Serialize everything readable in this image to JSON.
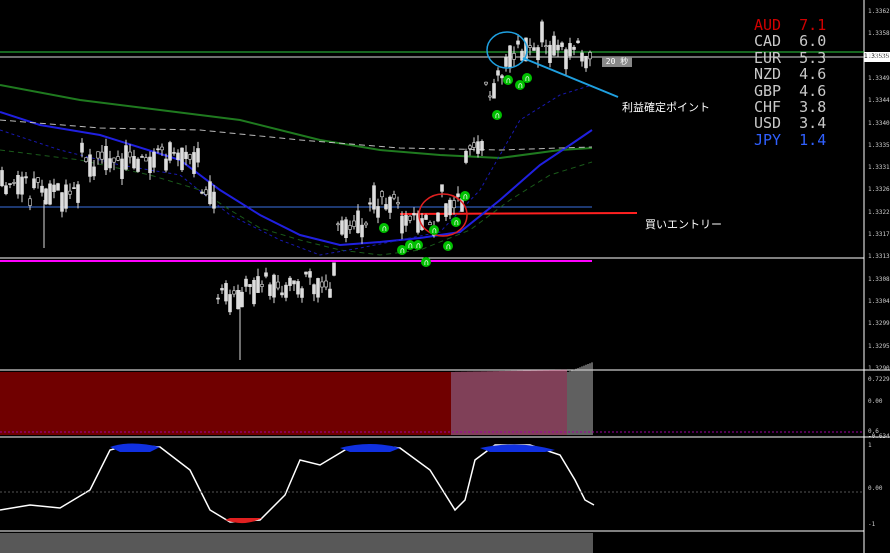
{
  "chart_data": [
    {
      "type": "candlestick",
      "panel": "main",
      "ylim": [
        1.329,
        1.3362
      ],
      "price_ticks": [
        "1.33625",
        "1.33580",
        "1.33535",
        "1.33490",
        "1.33445",
        "1.33400",
        "1.33355",
        "1.33310",
        "1.33265",
        "1.33220",
        "1.33175",
        "1.33130",
        "1.33085",
        "1.33040",
        "1.32995",
        "1.32950",
        "1.32905"
      ],
      "current_price": "1.33535",
      "seconds_label": "20 秒",
      "annotations": {
        "take_profit": "利益確定ポイント",
        "buy_entry": "買いエントリー"
      }
    },
    {
      "type": "bar",
      "panel": "histogram",
      "ticks": [
        "0.7229",
        "0.00",
        "0.6",
        "-0.6349"
      ],
      "colors": {
        "red_phase": "#e00000",
        "pink_phase": "#ff7fb0",
        "gray_phase": "#c0c0c0"
      }
    },
    {
      "type": "line",
      "panel": "oscillator",
      "ticks": [
        "1",
        "0.00",
        "-1"
      ]
    }
  ],
  "currency_strength": [
    {
      "name": "AUD",
      "value": "7.1",
      "color": "#d00000"
    },
    {
      "name": "CAD",
      "value": "6.0",
      "color": "#c8c8c8"
    },
    {
      "name": "EUR",
      "value": "5.3",
      "color": "#c8c8c8"
    },
    {
      "name": "NZD",
      "value": "4.6",
      "color": "#c8c8c8"
    },
    {
      "name": "GBP",
      "value": "4.6",
      "color": "#c8c8c8"
    },
    {
      "name": "CHF",
      "value": "3.8",
      "color": "#c8c8c8"
    },
    {
      "name": "USD",
      "value": "3.4",
      "color": "#c8c8c8"
    },
    {
      "name": "JPY",
      "value": "1.4",
      "color": "#3060ff"
    }
  ]
}
